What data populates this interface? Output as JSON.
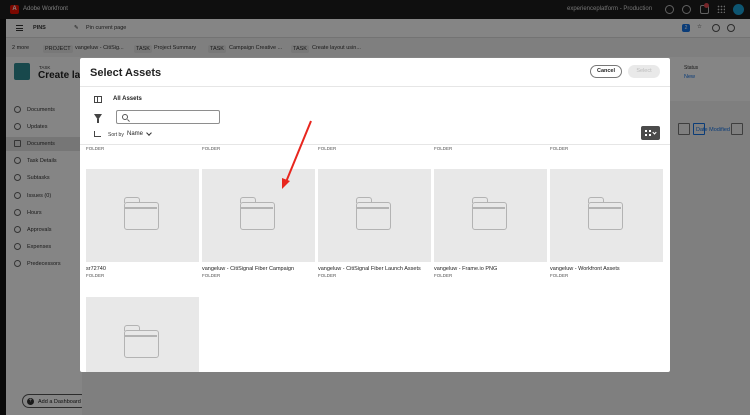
{
  "topbar": {
    "logo_letter": "A",
    "app_name": "Adobe Workfront",
    "environment": "experienceplatform - Production",
    "notification_count": ""
  },
  "navrow": {
    "pins_label": "PINS",
    "pin_label": "Pin current page",
    "square_badge": "2"
  },
  "breadcrumbs": {
    "more": "2 more",
    "project_tag": "PROJECT",
    "project_name": "vangeluw - CitiSig...",
    "task_tag1": "TASK",
    "task_name1": "Project Summary",
    "task_tag2": "TASK",
    "task_name2": "Campaign Creative ...",
    "task_tag3": "TASK",
    "task_name3": "Create layout usin..."
  },
  "header": {
    "task_label": "TASK",
    "title": "Create lay",
    "status_label": "Status",
    "status_value": "New"
  },
  "sidebar": {
    "items": [
      {
        "label": "Documents"
      },
      {
        "label": "Updates"
      },
      {
        "label": "Documents"
      },
      {
        "label": "Task Details"
      },
      {
        "label": "Subtasks"
      },
      {
        "label": "Issues (0)"
      },
      {
        "label": "Hours"
      },
      {
        "label": "Approvals"
      },
      {
        "label": "Expenses"
      },
      {
        "label": "Predecessors"
      }
    ],
    "add_dashboard": "Add a Dashboard"
  },
  "workarea": {
    "sort_label": "Date Modified"
  },
  "modal": {
    "title": "Select Assets",
    "cancel_label": "Cancel",
    "select_label": "Select",
    "location": "All Assets",
    "search_placeholder": "",
    "sort_by_label": "Sort by",
    "sort_value": "Name",
    "top_row_types": [
      "FOLDER",
      "FOLDER",
      "FOLDER",
      "FOLDER",
      "FOLDER"
    ],
    "folders": [
      {
        "name": "sr72740",
        "type": "FOLDER"
      },
      {
        "name": "vangeluw - CitiSignal Fiber Campaign",
        "type": "FOLDER"
      },
      {
        "name": "vangeluw - CitiSignal Fiber Launch Assets",
        "type": "FOLDER"
      },
      {
        "name": "vangeluw - Frame.io PNG",
        "type": "FOLDER"
      },
      {
        "name": "vangeluw - Workfront Assets",
        "type": "FOLDER"
      },
      {
        "name": "",
        "type": ""
      }
    ]
  },
  "colors": {
    "accent": "#1473e6",
    "annotation_arrow": "#e8261e",
    "task_icon": "#2f8a93"
  }
}
